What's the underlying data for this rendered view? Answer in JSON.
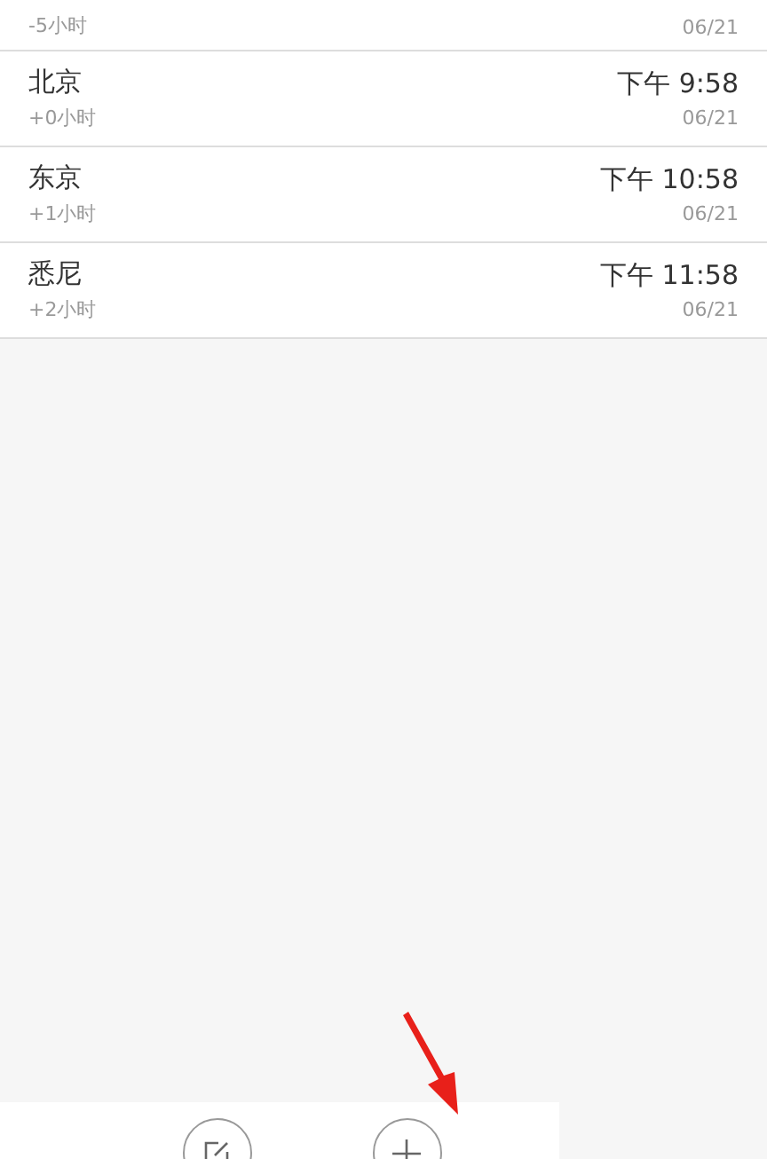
{
  "cities": [
    {
      "offset": "-5小时",
      "date": "06/21"
    },
    {
      "name": "北京",
      "offset": "+0小时",
      "time": "下午 9:58",
      "date": "06/21"
    },
    {
      "name": "东京",
      "offset": "+1小时",
      "time": "下午 10:58",
      "date": "06/21"
    },
    {
      "name": "悉尼",
      "offset": "+2小时",
      "time": "下午 11:58",
      "date": "06/21"
    }
  ],
  "toolbar": {
    "buttons": [
      {
        "kind": "edit"
      },
      {
        "kind": "add"
      }
    ]
  }
}
